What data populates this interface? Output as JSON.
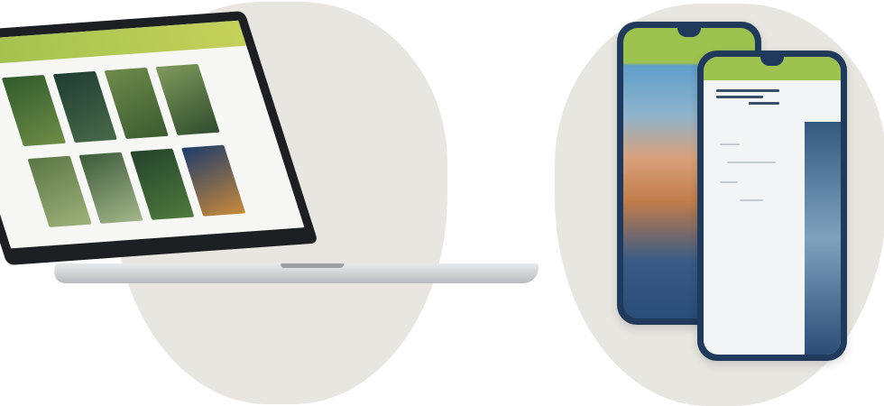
{
  "scene": {
    "description_visible_text": "",
    "devices": [
      "laptop",
      "phone",
      "phone"
    ]
  },
  "colors": {
    "backdrop": "#e8e6e1",
    "accent_green": "#9ec24f",
    "phone_frame": "#1f3a5a",
    "laptop_bezel": "#1d1f22"
  },
  "laptop": {
    "tiles": 8
  }
}
